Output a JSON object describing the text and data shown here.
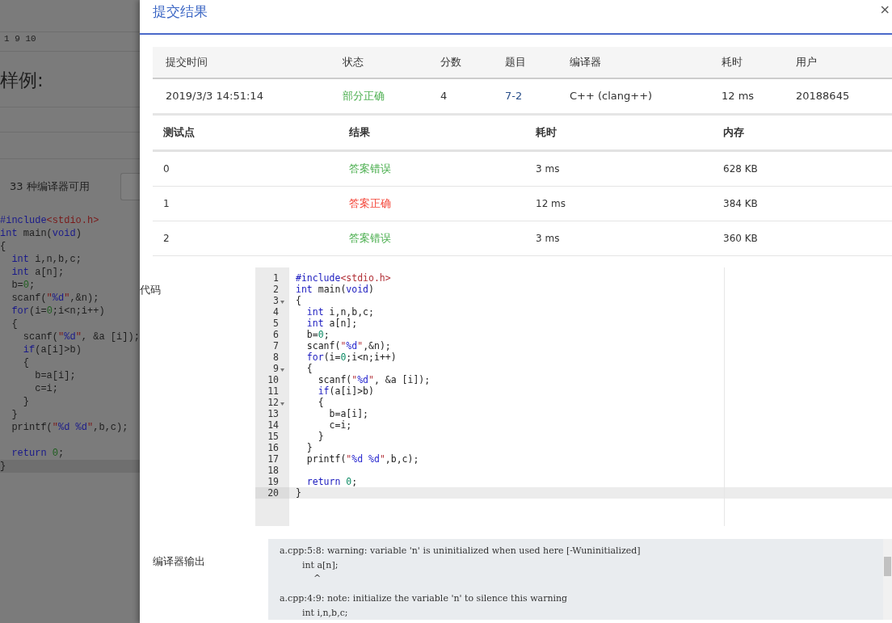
{
  "background": {
    "sample_numbers": "1 9 10",
    "sample_heading": "样例:",
    "compiler_count": "33 种编译器可用",
    "code": [
      {
        "tokens": [
          {
            "t": "#include",
            "kind": "kw"
          },
          {
            "t": "<stdio.h>",
            "kind": "str"
          }
        ]
      },
      {
        "tokens": [
          {
            "t": "int",
            "kind": "kw"
          },
          {
            "t": " main(",
            "kind": "p"
          },
          {
            "t": "void",
            "kind": "kw"
          },
          {
            "t": ")",
            "kind": "p"
          }
        ]
      },
      {
        "tokens": [
          {
            "t": "{",
            "kind": "p"
          }
        ]
      },
      {
        "tokens": [
          {
            "t": "  int",
            "kind": "kw"
          },
          {
            "t": " i,n,b,c;",
            "kind": "p"
          }
        ]
      },
      {
        "tokens": [
          {
            "t": "  int",
            "kind": "kw"
          },
          {
            "t": " a[n];",
            "kind": "p"
          }
        ]
      },
      {
        "tokens": [
          {
            "t": "  b=",
            "kind": "p"
          },
          {
            "t": "0",
            "kind": "num"
          },
          {
            "t": ";",
            "kind": "p"
          }
        ]
      },
      {
        "tokens": [
          {
            "t": "  scanf(",
            "kind": "p"
          },
          {
            "t": "\"",
            "kind": "str"
          },
          {
            "t": "%d",
            "kind": "fmt"
          },
          {
            "t": "\"",
            "kind": "str"
          },
          {
            "t": ",&n);",
            "kind": "p"
          }
        ]
      },
      {
        "tokens": [
          {
            "t": "  for",
            "kind": "kw"
          },
          {
            "t": "(i=",
            "kind": "p"
          },
          {
            "t": "0",
            "kind": "num"
          },
          {
            "t": ";i<n;i++)",
            "kind": "p"
          }
        ]
      },
      {
        "tokens": [
          {
            "t": "  {",
            "kind": "p"
          }
        ]
      },
      {
        "tokens": [
          {
            "t": "    scanf(",
            "kind": "p"
          },
          {
            "t": "\"",
            "kind": "str"
          },
          {
            "t": "%d",
            "kind": "fmt"
          },
          {
            "t": "\"",
            "kind": "str"
          },
          {
            "t": ", &a [i]);",
            "kind": "p"
          }
        ]
      },
      {
        "tokens": [
          {
            "t": "    if",
            "kind": "kw"
          },
          {
            "t": "(a[i]>b)",
            "kind": "p"
          }
        ]
      },
      {
        "tokens": [
          {
            "t": "    {",
            "kind": "p"
          }
        ]
      },
      {
        "tokens": [
          {
            "t": "      b=a[i];",
            "kind": "p"
          }
        ]
      },
      {
        "tokens": [
          {
            "t": "      c=i;",
            "kind": "p"
          }
        ]
      },
      {
        "tokens": [
          {
            "t": "    }",
            "kind": "p"
          }
        ]
      },
      {
        "tokens": [
          {
            "t": "  }",
            "kind": "p"
          }
        ]
      },
      {
        "tokens": [
          {
            "t": "  printf(",
            "kind": "p"
          },
          {
            "t": "\"",
            "kind": "str"
          },
          {
            "t": "%d %d",
            "kind": "fmt"
          },
          {
            "t": "\"",
            "kind": "str"
          },
          {
            "t": ",b,c);",
            "kind": "p"
          }
        ],
        "gap_after": true
      },
      {
        "tokens": [
          {
            "t": "  return ",
            "kind": "kw"
          },
          {
            "t": "0",
            "kind": "num"
          },
          {
            "t": ";",
            "kind": "p"
          }
        ]
      },
      {
        "tokens": [
          {
            "t": "}",
            "kind": "p"
          }
        ],
        "active": true
      }
    ]
  },
  "dialog": {
    "title": "提交结果",
    "close": "×",
    "summary": {
      "columns": [
        "提交时间",
        "状态",
        "分数",
        "题目",
        "编译器",
        "耗时",
        "用户"
      ],
      "row": {
        "time": "2019/3/3 14:51:14",
        "status": "部分正确",
        "color": "#4caf50",
        "score": "4",
        "problem": "7-2",
        "compiler": "C++ (clang++)",
        "duration": "12 ms",
        "user": "20188645"
      }
    },
    "tests": {
      "columns": [
        "测试点",
        "结果",
        "耗时",
        "内存"
      ],
      "rows": [
        {
          "case": "0",
          "result": "答案错误",
          "color": "#4caf50",
          "time": "3 ms",
          "memory": "628 KB"
        },
        {
          "case": "1",
          "result": "答案正确",
          "color": "#f44336",
          "time": "12 ms",
          "memory": "384 KB"
        },
        {
          "case": "2",
          "result": "答案错误",
          "color": "#4caf50",
          "time": "3 ms",
          "memory": "360 KB"
        }
      ]
    },
    "code_label": "代码",
    "code": [
      {
        "n": "1",
        "tokens": [
          {
            "t": "#include",
            "kind": "kw"
          },
          {
            "t": "<stdio.h>",
            "kind": "str"
          }
        ]
      },
      {
        "n": "2",
        "tokens": [
          {
            "t": "int",
            "kind": "kw"
          },
          {
            "t": " main(",
            "kind": "p"
          },
          {
            "t": "void",
            "kind": "kw"
          },
          {
            "t": ")",
            "kind": "p"
          }
        ]
      },
      {
        "n": "3",
        "fold": true,
        "tokens": [
          {
            "t": "{",
            "kind": "p"
          }
        ]
      },
      {
        "n": "4",
        "tokens": [
          {
            "t": "  int",
            "kind": "kw"
          },
          {
            "t": " i,n,b,c;",
            "kind": "p"
          }
        ]
      },
      {
        "n": "5",
        "tokens": [
          {
            "t": "  int",
            "kind": "kw"
          },
          {
            "t": " a[n];",
            "kind": "p"
          }
        ]
      },
      {
        "n": "6",
        "tokens": [
          {
            "t": "  b=",
            "kind": "p"
          },
          {
            "t": "0",
            "kind": "num"
          },
          {
            "t": ";",
            "kind": "p"
          }
        ]
      },
      {
        "n": "7",
        "tokens": [
          {
            "t": "  scanf(",
            "kind": "p"
          },
          {
            "t": "\"",
            "kind": "str"
          },
          {
            "t": "%d",
            "kind": "fmt"
          },
          {
            "t": "\"",
            "kind": "str"
          },
          {
            "t": ",&n);",
            "kind": "p"
          }
        ]
      },
      {
        "n": "8",
        "tokens": [
          {
            "t": "  for",
            "kind": "kw"
          },
          {
            "t": "(i=",
            "kind": "p"
          },
          {
            "t": "0",
            "kind": "num"
          },
          {
            "t": ";i<n;i++)",
            "kind": "p"
          }
        ]
      },
      {
        "n": "9",
        "fold": true,
        "tokens": [
          {
            "t": "  {",
            "kind": "p"
          }
        ]
      },
      {
        "n": "10",
        "tokens": [
          {
            "t": "    scanf(",
            "kind": "p"
          },
          {
            "t": "\"",
            "kind": "str"
          },
          {
            "t": "%d",
            "kind": "fmt"
          },
          {
            "t": "\"",
            "kind": "str"
          },
          {
            "t": ", &a [i]);",
            "kind": "p"
          }
        ]
      },
      {
        "n": "11",
        "tokens": [
          {
            "t": "    if",
            "kind": "kw"
          },
          {
            "t": "(a[i]>b)",
            "kind": "p"
          }
        ]
      },
      {
        "n": "12",
        "fold": true,
        "tokens": [
          {
            "t": "    {",
            "kind": "p"
          }
        ]
      },
      {
        "n": "13",
        "tokens": [
          {
            "t": "      b=a[i];",
            "kind": "p"
          }
        ]
      },
      {
        "n": "14",
        "tokens": [
          {
            "t": "      c=i;",
            "kind": "p"
          }
        ]
      },
      {
        "n": "15",
        "tokens": [
          {
            "t": "    }",
            "kind": "p"
          }
        ]
      },
      {
        "n": "16",
        "tokens": [
          {
            "t": "  }",
            "kind": "p"
          }
        ]
      },
      {
        "n": "17",
        "tokens": [
          {
            "t": "  printf(",
            "kind": "p"
          },
          {
            "t": "\"",
            "kind": "str"
          },
          {
            "t": "%d %d",
            "kind": "fmt"
          },
          {
            "t": "\"",
            "kind": "str"
          },
          {
            "t": ",b,c);",
            "kind": "p"
          }
        ]
      },
      {
        "n": "18"
      },
      {
        "n": "19",
        "tokens": [
          {
            "t": "  return ",
            "kind": "kw"
          },
          {
            "t": "0",
            "kind": "num"
          },
          {
            "t": ";",
            "kind": "p"
          }
        ]
      },
      {
        "n": "20",
        "active": true,
        "tokens": [
          {
            "t": "}",
            "kind": "p"
          }
        ]
      }
    ],
    "output_label": "编译器输出",
    "output_lines": [
      "a.cpp:5:8: warning: variable 'n' is uninitialized when used here [-Wuninitialized]",
      "        int a[n];",
      "            ^",
      "a.cpp:4:9: note: initialize the variable 'n' to silence this warning",
      "        int i,n,b,c;"
    ]
  }
}
